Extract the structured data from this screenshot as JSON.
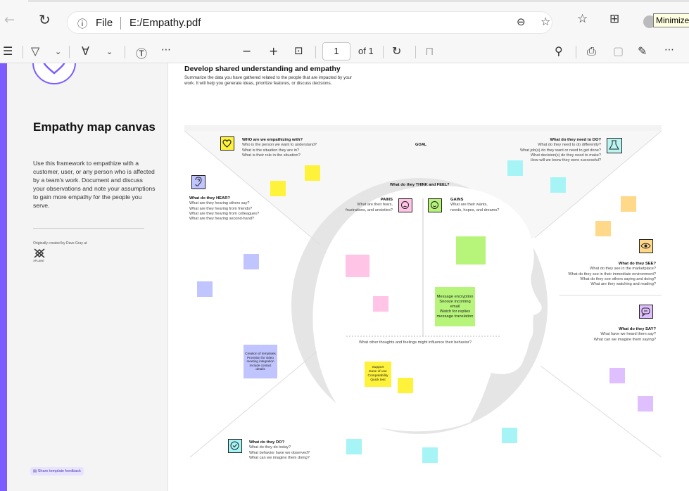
{
  "browser": {
    "url_prefix": "File",
    "url_path": "E:/Empathy.pdf",
    "tooltip": "Minimize"
  },
  "toolbar": {
    "page_current": "1",
    "page_total": "of 1"
  },
  "sidebar": {
    "title": "Empathy map canvas",
    "description": "Use this framework to empathize with a customer, user, or any person who is affected by a team's work. Document and discuss your observations and note your assumptions to gain more empathy for the people you serve.",
    "credit": "Originally created by Dave Gray at",
    "logo_text": "XPLANE",
    "feedback": "Share template feedback"
  },
  "canvas": {
    "heading": "Develop shared understanding and empathy",
    "subheading": "Summarize the data you have gathered related to the people that are impacted by your work. It will help you generate ideas, prioritize features, or discuss decisions.",
    "goal": "GOAL",
    "who": {
      "title": "WHO are we empathizing with?",
      "lines": [
        "Who is the person we want to understand?",
        "What is the situation they are in?",
        "What is their role in the situation?"
      ]
    },
    "do_need": {
      "title": "What do they need to DO?",
      "lines": [
        "What do they need to do differently?",
        "What job(s) do they want or need to get done?",
        "What decision(s) do they need to make?",
        "How will we know they were successful?"
      ]
    },
    "hear": {
      "title": "What do they HEAR?",
      "lines": [
        "What are they hearing others say?",
        "What are they hearing from friends?",
        "What are they hearing from colleagues?",
        "What are they hearing second-hand?"
      ]
    },
    "think_feel": "What do they THINK and FEEL?",
    "pains": {
      "title": "PAINS",
      "lines": [
        "What are their fears,",
        "frustrations, and anxieties?"
      ]
    },
    "gains": {
      "title": "GAINS",
      "lines": [
        "What are their wants,",
        "needs, hopes, and dreams?"
      ]
    },
    "see": {
      "title": "What do they SEE?",
      "lines": [
        "What do they see in the marketplace?",
        "What do they see in their immediate environment?",
        "What do they see others saying and doing?",
        "What are they watching and reading?"
      ]
    },
    "say": {
      "title": "What do they SAY?",
      "lines": [
        "What have we heard them say?",
        "What can we imagine them saying?"
      ]
    },
    "other_thoughts": "What other thoughts and feelings might influence their behavior?",
    "do": {
      "title": "What do they DO?",
      "lines": [
        "What do they do today?",
        "What behavior have we observed?",
        "What can we imagine them doing?"
      ]
    },
    "notes": {
      "gains_note": "Message encryption\nSnooze incoming email\nWatch for replies\nmessage translation",
      "hear_note": "Creation of templates\nProvision for video meeting integration\nInclude contact details",
      "other_note": "Support\nEase of use\nCompatability\nQuick test"
    }
  },
  "colors": {
    "accent": "#7c5cff",
    "yellow": "#fff23a",
    "green": "#b7f57a",
    "pink": "#ffc4e6",
    "cyan": "#a6f4f6",
    "orange": "#ffd88a",
    "lavender": "#c0c4ff",
    "purple": "#e0bfff"
  }
}
